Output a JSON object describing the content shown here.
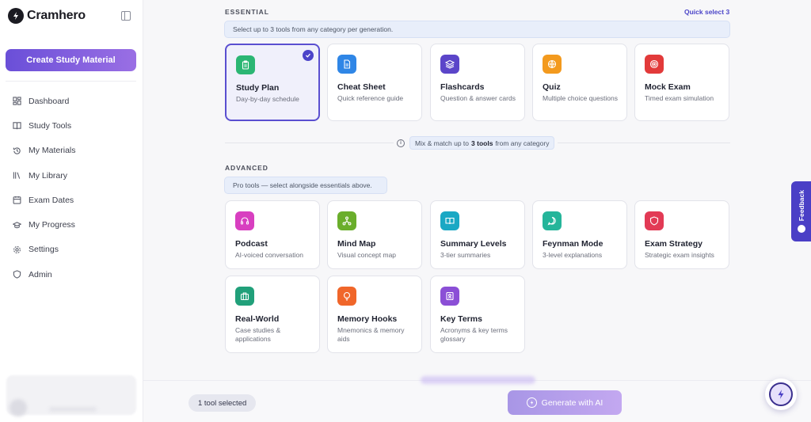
{
  "brand": {
    "name": "Cramhero"
  },
  "sidebar": {
    "create_label": "Create Study Material",
    "items": [
      {
        "label": "Dashboard",
        "icon": "dashboard-icon"
      },
      {
        "label": "Study Tools",
        "icon": "book-icon"
      },
      {
        "label": "My Materials",
        "icon": "history-icon"
      },
      {
        "label": "My Library",
        "icon": "library-icon"
      },
      {
        "label": "Exam Dates",
        "icon": "calendar-icon"
      },
      {
        "label": "My Progress",
        "icon": "graduation-cap-icon"
      },
      {
        "label": "Settings",
        "icon": "gear-icon"
      },
      {
        "label": "Admin",
        "icon": "shield-icon"
      }
    ]
  },
  "essential": {
    "title": "ESSENTIAL",
    "quick_select": "Quick select 3",
    "info": "Select up to 3 tools from any category per generation.",
    "cards": [
      {
        "title": "Study Plan",
        "desc": "Day-by-day schedule",
        "color": "#2bb673",
        "icon": "clipboard-icon",
        "selected": true
      },
      {
        "title": "Cheat Sheet",
        "desc": "Quick reference guide",
        "color": "#2f86e6",
        "icon": "document-icon",
        "selected": false
      },
      {
        "title": "Flashcards",
        "desc": "Question & answer cards",
        "color": "#5b45c9",
        "icon": "layers-icon",
        "selected": false
      },
      {
        "title": "Quiz",
        "desc": "Multiple choice questions",
        "color": "#f39a1e",
        "icon": "globe-icon",
        "selected": false
      },
      {
        "title": "Mock Exam",
        "desc": "Timed exam simulation",
        "color": "#e23a3a",
        "icon": "target-icon",
        "selected": false
      }
    ]
  },
  "mix": {
    "pre": "Mix & match up to",
    "bold": "3 tools",
    "post": "from any category"
  },
  "advanced": {
    "title": "ADVANCED",
    "info": "Pro tools — select alongside essentials above.",
    "cards": [
      {
        "title": "Podcast",
        "desc": "AI-voiced conversation",
        "color": "#d83fc0",
        "icon": "headphones-icon"
      },
      {
        "title": "Mind Map",
        "desc": "Visual concept map",
        "color": "#6aae2b",
        "icon": "network-icon"
      },
      {
        "title": "Summary Levels",
        "desc": "3-tier summaries",
        "color": "#1aa8c4",
        "icon": "open-book-icon"
      },
      {
        "title": "Feynman Mode",
        "desc": "3-level explanations",
        "color": "#25b59a",
        "icon": "chat-icon"
      },
      {
        "title": "Exam Strategy",
        "desc": "Strategic exam insights",
        "color": "#e23a55",
        "icon": "shield-icon"
      },
      {
        "title": "Real-World",
        "desc": "Case studies & applications",
        "color": "#21a07a",
        "icon": "briefcase-icon"
      },
      {
        "title": "Memory Hooks",
        "desc": "Mnemonics & memory aids",
        "color": "#f0662a",
        "icon": "lightbulb-icon"
      },
      {
        "title": "Key Terms",
        "desc": "Acronyms & key terms glossary",
        "color": "#8b4fd6",
        "icon": "id-card-icon"
      }
    ]
  },
  "bottom": {
    "selected_label": "1 tool selected",
    "generate_label": "Generate with AI"
  },
  "feedback_label": "Feedback",
  "colors": {
    "accent": "#5a4fd0",
    "create_gradient_start": "#6a4fd8",
    "create_gradient_end": "#9a6fe4",
    "feedback_tab": "#4a3fc6"
  }
}
